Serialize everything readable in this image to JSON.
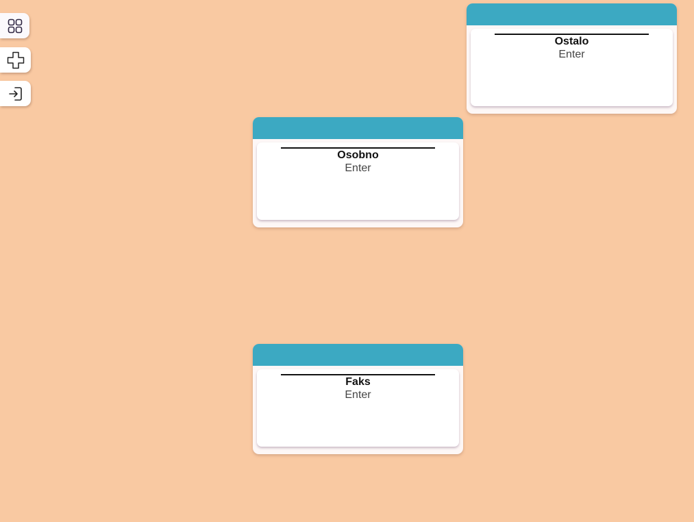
{
  "sidebar": {
    "buttons": [
      {
        "icon": "grid-icon"
      },
      {
        "icon": "plus-icon"
      },
      {
        "icon": "login-icon"
      }
    ]
  },
  "cards": [
    {
      "title": "Ostalo",
      "value": "Enter"
    },
    {
      "title": "Osobno",
      "value": "Enter"
    },
    {
      "title": "Faks",
      "value": "Enter"
    }
  ],
  "colors": {
    "background": "#f9c9a2",
    "card_header": "#3ca9c2",
    "card_body": "#ffffff"
  }
}
